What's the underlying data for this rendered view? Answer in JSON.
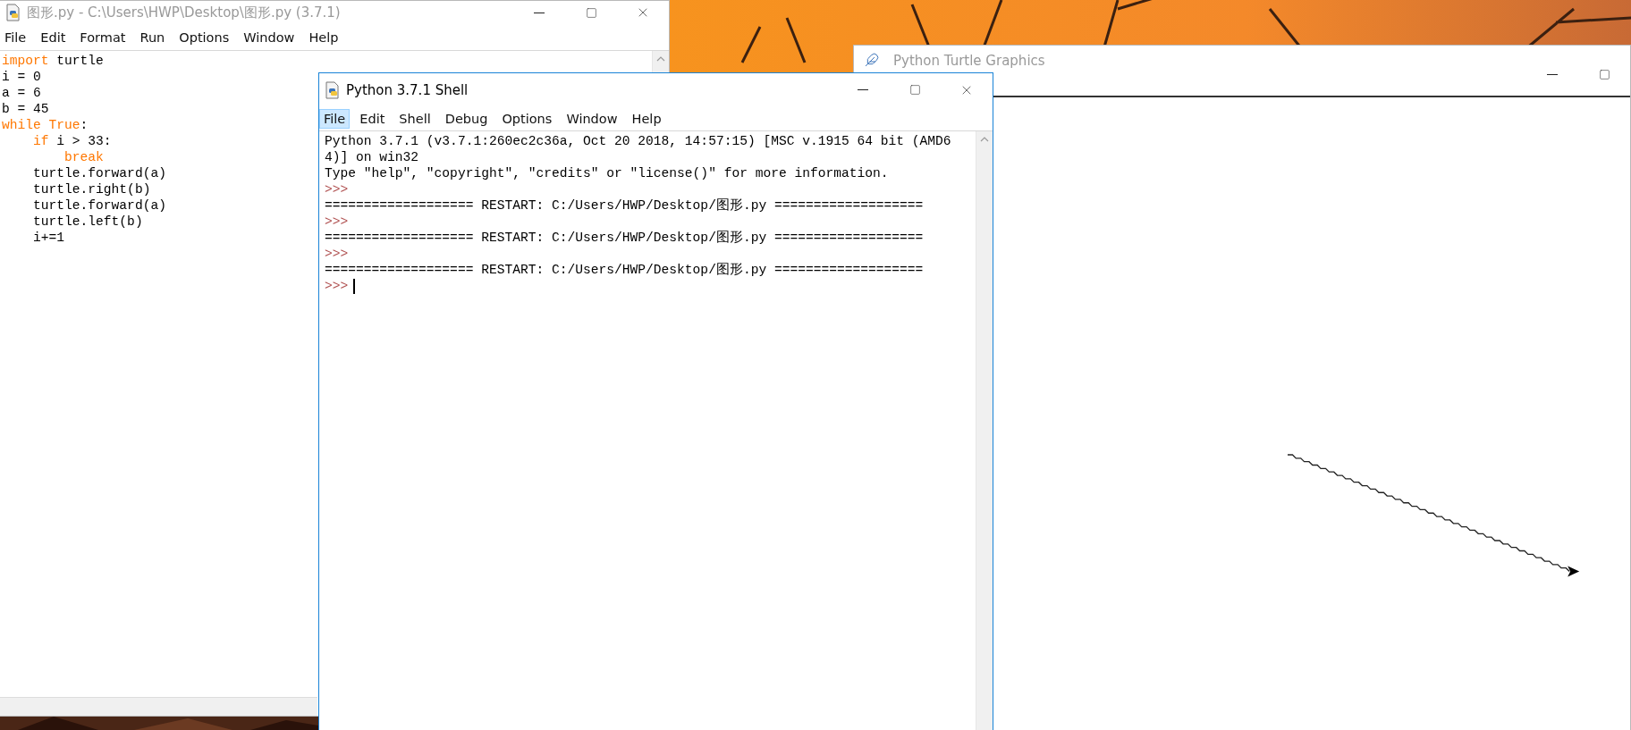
{
  "editor": {
    "title": "图形.py - C:\\Users\\HWP\\Desktop\\图形.py (3.7.1)",
    "menu": [
      "File",
      "Edit",
      "Format",
      "Run",
      "Options",
      "Window",
      "Help"
    ],
    "code": [
      {
        "parts": [
          {
            "kind": "keyword",
            "text": "import"
          },
          {
            "kind": "plain",
            "text": " turtle"
          }
        ]
      },
      {
        "parts": [
          {
            "kind": "plain",
            "text": "i = 0"
          }
        ]
      },
      {
        "parts": [
          {
            "kind": "plain",
            "text": "a = 6"
          }
        ]
      },
      {
        "parts": [
          {
            "kind": "plain",
            "text": "b = 45"
          }
        ]
      },
      {
        "parts": [
          {
            "kind": "keyword",
            "text": "while True"
          },
          {
            "kind": "plain",
            "text": ":"
          }
        ]
      },
      {
        "parts": [
          {
            "kind": "keyword",
            "text": "    if"
          },
          {
            "kind": "plain",
            "text": " i > 33:"
          }
        ]
      },
      {
        "parts": [
          {
            "kind": "keyword",
            "text": "        break"
          }
        ]
      },
      {
        "parts": [
          {
            "kind": "plain",
            "text": "    turtle.forward(a)"
          }
        ]
      },
      {
        "parts": [
          {
            "kind": "plain",
            "text": "    turtle.right(b)"
          }
        ]
      },
      {
        "parts": [
          {
            "kind": "plain",
            "text": "    turtle.forward(a)"
          }
        ]
      },
      {
        "parts": [
          {
            "kind": "plain",
            "text": "    turtle.left(b)"
          }
        ]
      },
      {
        "parts": [
          {
            "kind": "plain",
            "text": "    i+=1"
          }
        ]
      }
    ]
  },
  "shell": {
    "title": "Python 3.7.1 Shell",
    "menu": [
      {
        "label": "File",
        "selected": true
      },
      {
        "label": "Edit",
        "selected": false
      },
      {
        "label": "Shell",
        "selected": false
      },
      {
        "label": "Debug",
        "selected": false
      },
      {
        "label": "Options",
        "selected": false
      },
      {
        "label": "Window",
        "selected": false
      },
      {
        "label": "Help",
        "selected": false
      }
    ],
    "lines": [
      {
        "kind": "output",
        "text": "Python 3.7.1 (v3.7.1:260ec2c36a, Oct 20 2018, 14:57:15) [MSC v.1915 64 bit (AMD6"
      },
      {
        "kind": "output",
        "text": "4)] on win32"
      },
      {
        "kind": "output",
        "text": "Type \"help\", \"copyright\", \"credits\" or \"license()\" for more information."
      },
      {
        "kind": "prompt",
        "text": ">>>"
      },
      {
        "kind": "output",
        "text": "=================== RESTART: C:/Users/HWP/Desktop/图形.py ==================="
      },
      {
        "kind": "prompt",
        "text": ">>>"
      },
      {
        "kind": "output",
        "text": "=================== RESTART: C:/Users/HWP/Desktop/图形.py ==================="
      },
      {
        "kind": "prompt",
        "text": ">>>"
      },
      {
        "kind": "output",
        "text": "=================== RESTART: C:/Users/HWP/Desktop/图形.py ==================="
      },
      {
        "kind": "input",
        "text": ">>>"
      }
    ]
  },
  "turtle_window": {
    "title": "Python Turtle Graphics"
  }
}
